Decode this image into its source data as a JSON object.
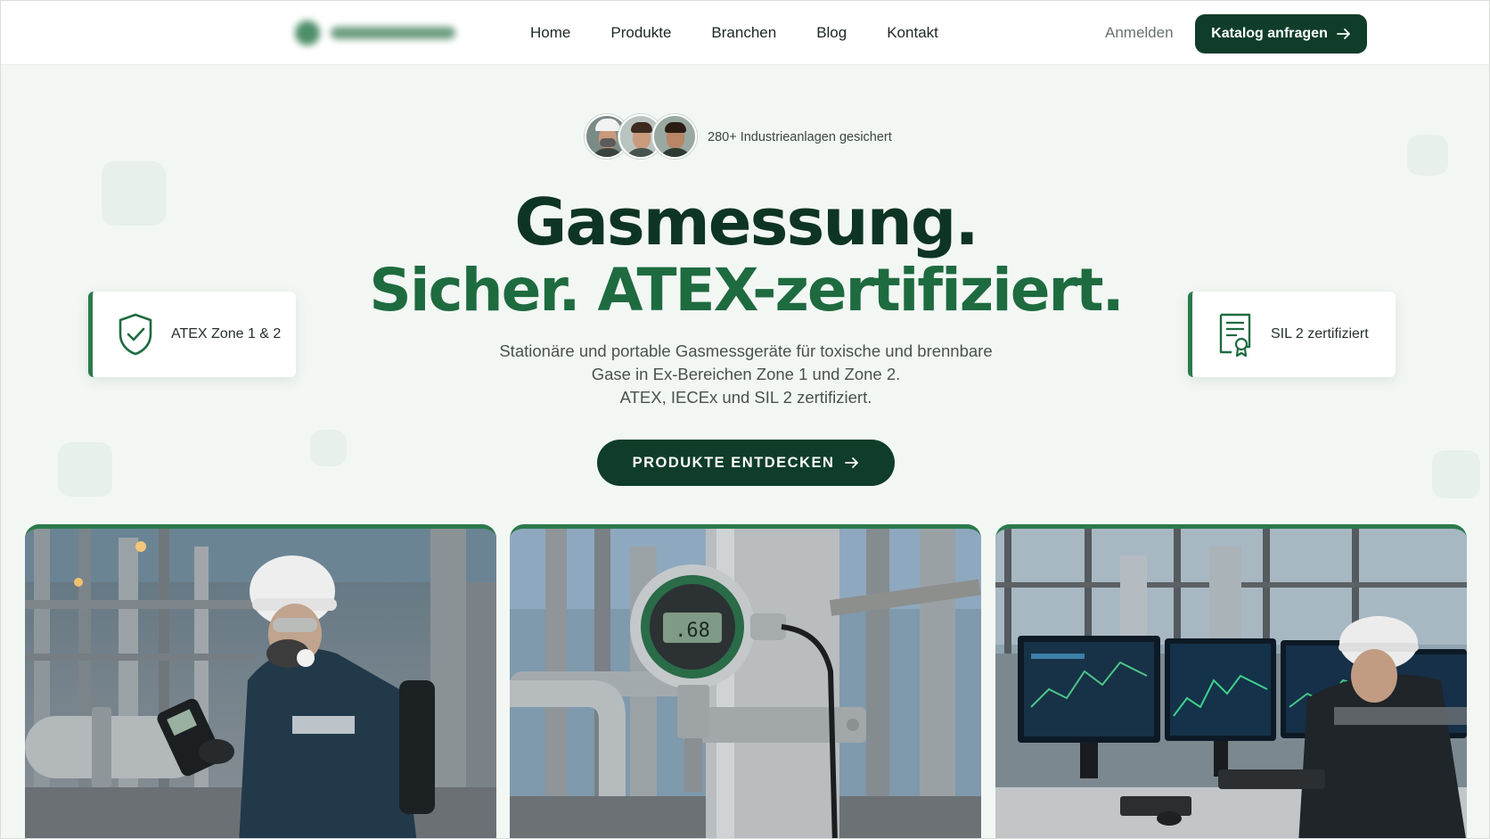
{
  "nav": {
    "links": [
      "Home",
      "Produkte",
      "Branchen",
      "Blog",
      "Kontakt"
    ],
    "login_label": "Anmelden",
    "cta_label": "Katalog anfragen",
    "cta_icon": "arrow-right-icon"
  },
  "hero": {
    "social_proof": "280+ Industrieanlagen gesichert",
    "headline_line1": "Gasmessung.",
    "headline_line2": "Sicher. ATEX-zertifiziert.",
    "subtitle_line1": "Stationäre und portable Gasmessgeräte für toxische und brennbare",
    "subtitle_line2": "Gase in Ex-Bereichen Zone 1 und Zone 2.",
    "subtitle_line3": "ATEX, IECEx und SIL 2 zertifiziert.",
    "cta_label": "PRODUKTE ENTDECKEN",
    "cta_icon": "arrow-right-icon"
  },
  "badges": [
    {
      "label": "ATEX Zone 1 & 2",
      "icon": "shield-check-icon"
    },
    {
      "label": "SIL 2 zertifiziert",
      "icon": "certificate-icon"
    }
  ],
  "gallery": [
    {
      "subject": "worker-with-portable-detector-photo"
    },
    {
      "subject": "fixed-gas-detector-on-pipe-photo"
    },
    {
      "subject": "control-room-monitoring-photo"
    }
  ],
  "colors": {
    "primary_dark": "#0f3d2a",
    "accent_green": "#1e6b40",
    "background": "#f3f7f4"
  }
}
